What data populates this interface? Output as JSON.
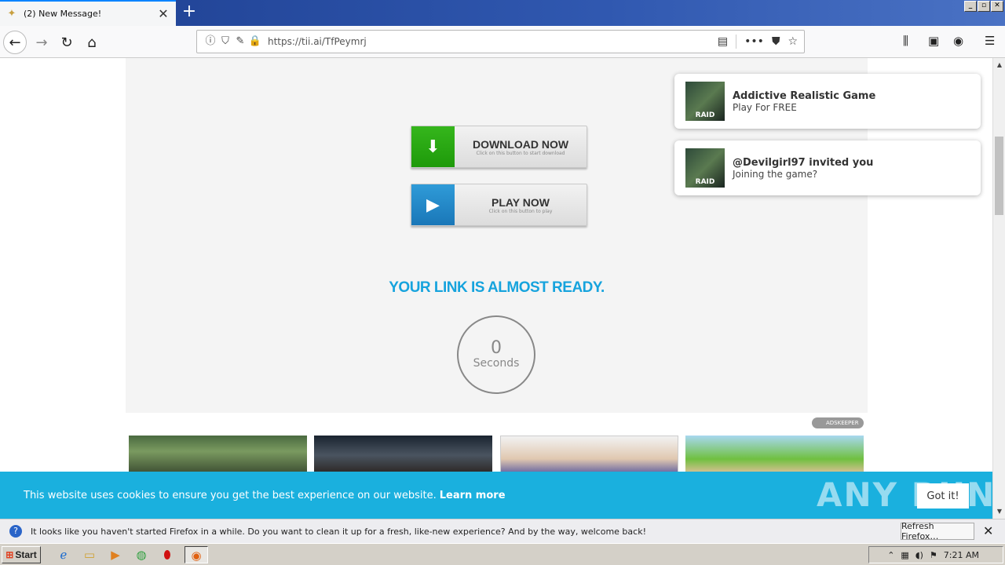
{
  "browser": {
    "tab_title": "(2) New Message!",
    "tab_close": "✕",
    "new_tab": "+",
    "url": "https://tii.ai/TfPeymrj",
    "window_buttons": [
      "_",
      "▫",
      "✕"
    ]
  },
  "page": {
    "download_button": {
      "main": "DOWNLOAD NOW",
      "sub": "Click on this button to start download"
    },
    "play_button": {
      "main": "PLAY NOW",
      "sub": "Click on this button to play"
    },
    "ready_text": "YOUR LINK IS ALMOST READY.",
    "timer": {
      "value": "0",
      "label": "Seconds"
    },
    "adskeeper": "ADSKEEPER"
  },
  "notifications": [
    {
      "title": "Addictive Realistic Game",
      "text": "Play For FREE",
      "thumb_label": "RAID"
    },
    {
      "title": "@Devilgirl97 invited you",
      "text": "Joining the game?",
      "thumb_label": "RAID"
    }
  ],
  "cookie_banner": {
    "text": "This website uses cookies to ensure you get the best experience on our website.",
    "link": "Learn more",
    "button": "Got it!",
    "watermark": "ANY RUN"
  },
  "firefox_notification": {
    "text": "It looks like you haven't started Firefox in a while. Do you want to clean it up for a fresh, like-new experience? And by the way, welcome back!",
    "button": "Refresh Firefox…"
  },
  "taskbar": {
    "start": "Start",
    "clock": "7:21 AM"
  },
  "colors": {
    "accent": "#16a3dd",
    "download_green": "#1e9a0a",
    "play_blue": "#1a77b8",
    "cookie_bg": "#1ab0de"
  }
}
